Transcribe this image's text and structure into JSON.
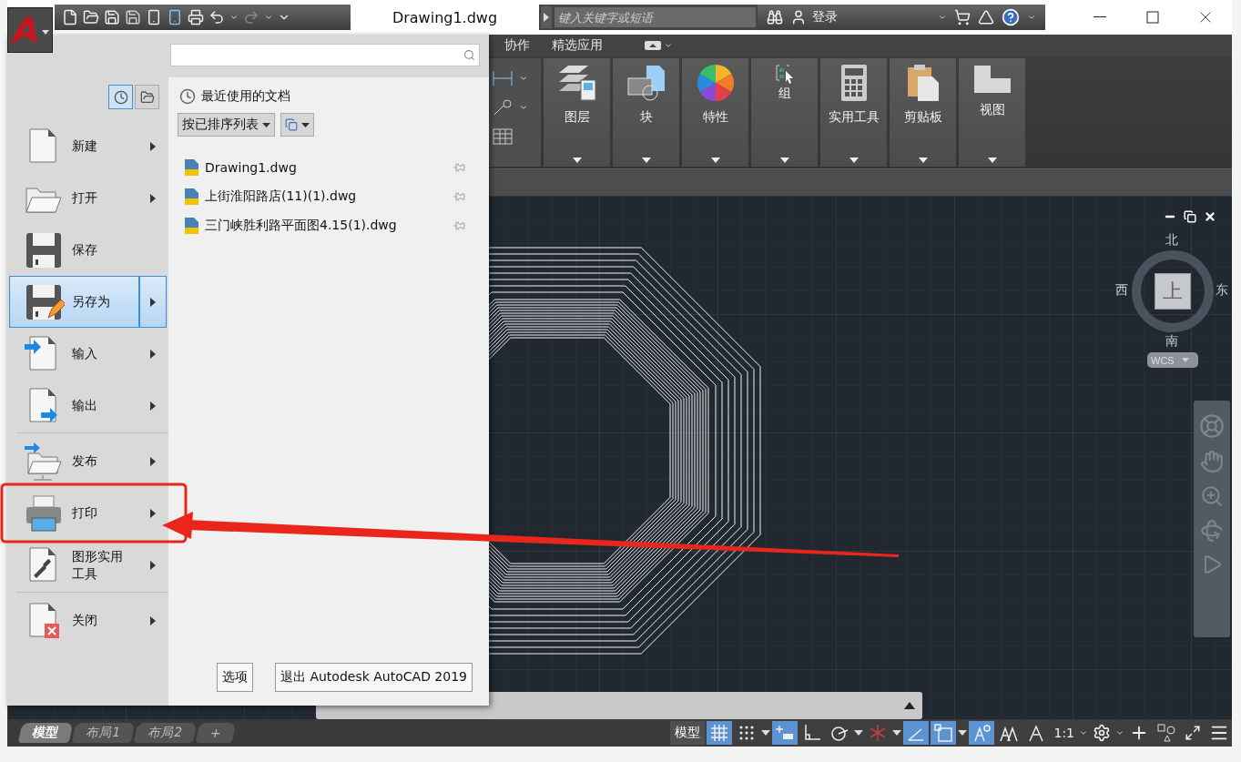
{
  "app_button": {
    "label": "A"
  },
  "quick_access": {
    "redo": {
      "disabled": true
    }
  },
  "window": {
    "title": "Drawing1.dwg"
  },
  "search": {
    "placeholder": "键入关键字或短语"
  },
  "account": {
    "sign_in": "登录"
  },
  "ribbon": {
    "tabs": [
      {
        "label": "协作",
        "selected": false
      },
      {
        "label": "精选应用",
        "selected": false
      }
    ],
    "panels": [
      {
        "label": "图层",
        "kind": "layers"
      },
      {
        "label": "块",
        "kind": "block"
      },
      {
        "label": "特性",
        "kind": "properties"
      },
      {
        "label": "组",
        "kind": "group"
      },
      {
        "label": "实用工具",
        "kind": "utilities"
      },
      {
        "label": "剪贴板",
        "kind": "clipboard"
      },
      {
        "label": "视图",
        "kind": "view"
      }
    ]
  },
  "app_menu": {
    "views": [
      {
        "kind": "recent",
        "selected": true
      },
      {
        "kind": "open",
        "selected": false
      }
    ],
    "commands": [
      {
        "label": "新建",
        "kind": "new",
        "submenu": true,
        "selected": false
      },
      {
        "label": "打开",
        "kind": "open",
        "submenu": true,
        "selected": false
      },
      {
        "label": "保存",
        "kind": "save",
        "submenu": false,
        "selected": false
      },
      {
        "label": "另存为",
        "kind": "saveas",
        "submenu": true,
        "selected": true
      },
      {
        "label": "输入",
        "kind": "import",
        "submenu": true,
        "selected": false
      },
      {
        "label": "输出",
        "kind": "export",
        "submenu": true,
        "selected": false
      },
      {
        "label": "发布",
        "kind": "publish",
        "submenu": true,
        "selected": false,
        "separator_before": true
      },
      {
        "label": "打印",
        "kind": "print",
        "submenu": true,
        "selected": false
      },
      {
        "label": "图形实用工具",
        "kind": "utilities",
        "submenu": true,
        "selected": false
      },
      {
        "label": "关闭",
        "kind": "close",
        "submenu": true,
        "selected": false,
        "separator_before": true
      }
    ],
    "recent": {
      "title": "最近使用的文档",
      "sort": "按已排序列表",
      "files": [
        {
          "name": "Drawing1.dwg"
        },
        {
          "name": "上街淮阳路店(11)(1).dwg"
        },
        {
          "name": "三门峡胜利路平面图4.15(1).dwg"
        }
      ]
    },
    "buttons": [
      {
        "label": "选项"
      },
      {
        "label": "退出 Autodesk AutoCAD 2019"
      }
    ]
  },
  "viewcube": {
    "north": "北",
    "south": "南",
    "west": "西",
    "east": "东",
    "face": "上",
    "ucs": "WCS"
  },
  "layout_tabs": [
    {
      "label": "模型",
      "selected": true
    },
    {
      "label": "布局1",
      "selected": false
    },
    {
      "label": "布局2",
      "selected": false
    }
  ],
  "add_layout": "+",
  "status_bar": {
    "model": "模型",
    "scale": "1:1",
    "toggles": [
      {
        "kind": "grid",
        "on": true,
        "menu": false
      },
      {
        "kind": "snap",
        "on": false,
        "menu": true
      },
      {
        "kind": "infer",
        "on": true,
        "menu": false
      },
      {
        "kind": "ortho",
        "on": false,
        "menu": false
      },
      {
        "kind": "polar",
        "on": false,
        "menu": true
      },
      {
        "kind": "iso",
        "on": false,
        "menu": true
      },
      {
        "kind": "track",
        "on": true,
        "menu": false
      },
      {
        "kind": "osnap",
        "on": true,
        "menu": true
      },
      {
        "kind": "annomonitor",
        "on": true,
        "menu": false
      },
      {
        "kind": "annovisible",
        "on": false,
        "menu": false
      },
      {
        "kind": "autoscale",
        "on": false,
        "menu": false
      }
    ]
  }
}
